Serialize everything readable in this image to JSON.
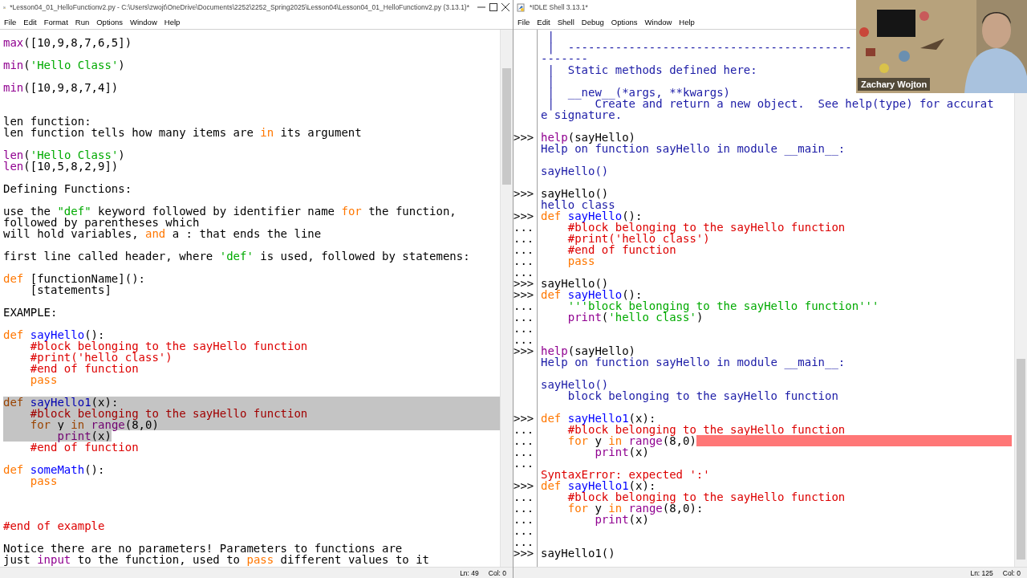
{
  "editor": {
    "title": "*Lesson04_01_HelloFunctionv2.py - C:\\Users\\zwojt\\OneDrive\\Documents\\2252\\2252_Spring2025\\Lesson04\\Lesson04_01_HelloFunctionv2.py (3.13.1)*",
    "menu": [
      "File",
      "Edit",
      "Format",
      "Run",
      "Options",
      "Window",
      "Help"
    ],
    "lines": [
      {
        "kind": "line",
        "selected": false,
        "segments": [
          {
            "kind": "builtin",
            "text": "max"
          },
          {
            "kind": "plain",
            "text": "([10,9,8,7,6,5])"
          }
        ]
      },
      {
        "kind": "blank"
      },
      {
        "kind": "line",
        "selected": false,
        "segments": [
          {
            "kind": "builtin",
            "text": "min"
          },
          {
            "kind": "plain",
            "text": "("
          },
          {
            "kind": "string",
            "text": "'Hello Class'"
          },
          {
            "kind": "plain",
            "text": ")"
          }
        ]
      },
      {
        "kind": "blank"
      },
      {
        "kind": "line",
        "selected": false,
        "segments": [
          {
            "kind": "builtin",
            "text": "min"
          },
          {
            "kind": "plain",
            "text": "([10,9,8,7,4])"
          }
        ]
      },
      {
        "kind": "blank"
      },
      {
        "kind": "blank"
      },
      {
        "kind": "line",
        "selected": false,
        "segments": [
          {
            "kind": "plain",
            "text": "len function:"
          }
        ]
      },
      {
        "kind": "line",
        "selected": false,
        "segments": [
          {
            "kind": "plain",
            "text": "len function tells how many items are "
          },
          {
            "kind": "keyword",
            "text": "in"
          },
          {
            "kind": "plain",
            "text": " its argument"
          }
        ]
      },
      {
        "kind": "blank"
      },
      {
        "kind": "line",
        "selected": false,
        "segments": [
          {
            "kind": "builtin",
            "text": "len"
          },
          {
            "kind": "plain",
            "text": "("
          },
          {
            "kind": "string",
            "text": "'Hello Class'"
          },
          {
            "kind": "plain",
            "text": ")"
          }
        ]
      },
      {
        "kind": "line",
        "selected": false,
        "segments": [
          {
            "kind": "builtin",
            "text": "len"
          },
          {
            "kind": "plain",
            "text": "([10,5,8,2,9])"
          }
        ]
      },
      {
        "kind": "blank"
      },
      {
        "kind": "line",
        "selected": false,
        "segments": [
          {
            "kind": "plain",
            "text": "Defining Functions:"
          }
        ]
      },
      {
        "kind": "blank"
      },
      {
        "kind": "line",
        "selected": false,
        "segments": [
          {
            "kind": "plain",
            "text": "use the "
          },
          {
            "kind": "string",
            "text": "\"def\""
          },
          {
            "kind": "plain",
            "text": " keyword followed by identifier name "
          },
          {
            "kind": "keyword",
            "text": "for"
          },
          {
            "kind": "plain",
            "text": " the function,"
          }
        ]
      },
      {
        "kind": "line",
        "selected": false,
        "segments": [
          {
            "kind": "plain",
            "text": "followed by parentheses which"
          }
        ]
      },
      {
        "kind": "line",
        "selected": false,
        "segments": [
          {
            "kind": "plain",
            "text": "will hold variables, "
          },
          {
            "kind": "keyword",
            "text": "and"
          },
          {
            "kind": "plain",
            "text": " a : that ends the line"
          }
        ]
      },
      {
        "kind": "blank"
      },
      {
        "kind": "line",
        "selected": false,
        "segments": [
          {
            "kind": "plain",
            "text": "first line called header, where "
          },
          {
            "kind": "string",
            "text": "'def'"
          },
          {
            "kind": "plain",
            "text": " is used, followed by statemens:"
          }
        ]
      },
      {
        "kind": "blank"
      },
      {
        "kind": "line",
        "selected": false,
        "segments": [
          {
            "kind": "keyword",
            "text": "def"
          },
          {
            "kind": "plain",
            "text": " [functionName]():"
          }
        ]
      },
      {
        "kind": "line",
        "selected": false,
        "segments": [
          {
            "kind": "plain",
            "text": "    [statements]"
          }
        ]
      },
      {
        "kind": "blank"
      },
      {
        "kind": "line",
        "selected": false,
        "segments": [
          {
            "kind": "plain",
            "text": "EXAMPLE:"
          }
        ]
      },
      {
        "kind": "blank"
      },
      {
        "kind": "line",
        "selected": false,
        "segments": [
          {
            "kind": "keyword",
            "text": "def"
          },
          {
            "kind": "definition",
            "text": " sayHello"
          },
          {
            "kind": "plain",
            "text": "():"
          }
        ]
      },
      {
        "kind": "line",
        "selected": false,
        "segments": [
          {
            "kind": "comment",
            "text": "    #block belonging to the sayHello function"
          }
        ]
      },
      {
        "kind": "line",
        "selected": false,
        "segments": [
          {
            "kind": "comment",
            "text": "    #print('hello class')"
          }
        ]
      },
      {
        "kind": "line",
        "selected": false,
        "segments": [
          {
            "kind": "comment",
            "text": "    #end of function"
          }
        ]
      },
      {
        "kind": "line",
        "selected": false,
        "segments": [
          {
            "kind": "keyword",
            "text": "    pass"
          }
        ]
      },
      {
        "kind": "blank"
      },
      {
        "kind": "line",
        "selected": true,
        "segments": [
          {
            "kind": "keyword",
            "text": "def"
          },
          {
            "kind": "definition",
            "text": " sayHello1"
          },
          {
            "kind": "plain",
            "text": "(x):"
          }
        ]
      },
      {
        "kind": "line",
        "selected": true,
        "segments": [
          {
            "kind": "comment",
            "text": "    #block belonging to the sayHello function"
          }
        ]
      },
      {
        "kind": "line",
        "selected": true,
        "segments": [
          {
            "kind": "keyword",
            "text": "    for"
          },
          {
            "kind": "plain",
            "text": " y "
          },
          {
            "kind": "keyword",
            "text": "in"
          },
          {
            "kind": "builtin",
            "text": " range"
          },
          {
            "kind": "plain",
            "text": "(8,0)"
          }
        ]
      },
      {
        "kind": "line",
        "selected": true,
        "segments": [
          {
            "kind": "builtin",
            "text": "        print"
          },
          {
            "kind": "plain",
            "text": "(x)"
          }
        ]
      },
      {
        "kind": "line",
        "selected": false,
        "segments": [
          {
            "kind": "comment",
            "text": "    #end of function"
          }
        ]
      },
      {
        "kind": "blank"
      },
      {
        "kind": "line",
        "selected": false,
        "segments": [
          {
            "kind": "keyword",
            "text": "def"
          },
          {
            "kind": "definition",
            "text": " someMath"
          },
          {
            "kind": "plain",
            "text": "():"
          }
        ]
      },
      {
        "kind": "line",
        "selected": false,
        "segments": [
          {
            "kind": "keyword",
            "text": "    pass"
          }
        ]
      },
      {
        "kind": "blank"
      },
      {
        "kind": "blank"
      },
      {
        "kind": "blank"
      },
      {
        "kind": "line",
        "selected": false,
        "segments": [
          {
            "kind": "comment",
            "text": "#end of example"
          }
        ]
      },
      {
        "kind": "blank"
      },
      {
        "kind": "line",
        "selected": false,
        "segments": [
          {
            "kind": "plain",
            "text": "Notice there are no parameters! Parameters to functions are"
          }
        ]
      },
      {
        "kind": "line",
        "selected": false,
        "segments": [
          {
            "kind": "plain",
            "text": "just "
          },
          {
            "kind": "builtin",
            "text": "input"
          },
          {
            "kind": "plain",
            "text": " to the function, used to "
          },
          {
            "kind": "keyword",
            "text": "pass"
          },
          {
            "kind": "plain",
            "text": " different values to it"
          }
        ]
      }
    ],
    "status": {
      "line": "Ln: 49",
      "column": "Col: 0"
    }
  },
  "shell": {
    "title": "*IDLE Shell 3.13.1*",
    "menu": [
      "File",
      "Edit",
      "Shell",
      "Debug",
      "Options",
      "Window",
      "Help"
    ],
    "lines": [
      {
        "kind": "line",
        "error_highlight": false,
        "segments": [
          {
            "kind": "output",
            "text": " |"
          }
        ]
      },
      {
        "kind": "line",
        "error_highlight": false,
        "segments": [
          {
            "kind": "output",
            "text": " |  ------------------------------------------"
          }
        ]
      },
      {
        "kind": "line",
        "error_highlight": false,
        "segments": [
          {
            "kind": "output",
            "text": "-------"
          }
        ]
      },
      {
        "kind": "line",
        "error_highlight": false,
        "segments": [
          {
            "kind": "output",
            "text": " |  Static methods defined here:"
          }
        ]
      },
      {
        "kind": "line",
        "error_highlight": false,
        "segments": [
          {
            "kind": "output",
            "text": " |"
          }
        ]
      },
      {
        "kind": "line",
        "error_highlight": false,
        "segments": [
          {
            "kind": "output",
            "text": " |  __new__(*args, **kwargs)"
          }
        ]
      },
      {
        "kind": "line",
        "error_highlight": false,
        "segments": [
          {
            "kind": "output",
            "text": " |      Create and return a new object.  See help(type) for accurat"
          }
        ]
      },
      {
        "kind": "line",
        "error_highlight": false,
        "segments": [
          {
            "kind": "output",
            "text": "e signature."
          }
        ]
      },
      {
        "kind": "blank"
      },
      {
        "kind": "line",
        "prompt": ">>>",
        "error_highlight": false,
        "segments": [
          {
            "kind": "builtin",
            "text": "help"
          },
          {
            "kind": "plain",
            "text": "(sayHello)"
          }
        ]
      },
      {
        "kind": "line",
        "error_highlight": false,
        "segments": [
          {
            "kind": "output",
            "text": "Help on function sayHello in module __main__:"
          }
        ]
      },
      {
        "kind": "blank"
      },
      {
        "kind": "line",
        "error_highlight": false,
        "segments": [
          {
            "kind": "output",
            "text": "sayHello()"
          }
        ]
      },
      {
        "kind": "blank"
      },
      {
        "kind": "line",
        "prompt": ">>>",
        "error_highlight": false,
        "segments": [
          {
            "kind": "plain",
            "text": "sayHello()"
          }
        ]
      },
      {
        "kind": "line",
        "error_highlight": false,
        "segments": [
          {
            "kind": "output",
            "text": "hello class"
          }
        ]
      },
      {
        "kind": "line",
        "prompt": ">>>",
        "error_highlight": false,
        "segments": [
          {
            "kind": "keyword",
            "text": "def"
          },
          {
            "kind": "definition",
            "text": " sayHello"
          },
          {
            "kind": "plain",
            "text": "():"
          }
        ]
      },
      {
        "kind": "line",
        "prompt": "...",
        "error_highlight": false,
        "segments": [
          {
            "kind": "comment",
            "text": "    #block belonging to the sayHello function"
          }
        ]
      },
      {
        "kind": "line",
        "prompt": "...",
        "error_highlight": false,
        "segments": [
          {
            "kind": "comment",
            "text": "    #print('hello class')"
          }
        ]
      },
      {
        "kind": "line",
        "prompt": "...",
        "error_highlight": false,
        "segments": [
          {
            "kind": "comment",
            "text": "    #end of function"
          }
        ]
      },
      {
        "kind": "line",
        "prompt": "...",
        "error_highlight": false,
        "segments": [
          {
            "kind": "keyword",
            "text": "    pass"
          }
        ]
      },
      {
        "kind": "line",
        "prompt": "...",
        "error_highlight": false
      },
      {
        "kind": "line",
        "prompt": ">>>",
        "error_highlight": false,
        "segments": [
          {
            "kind": "plain",
            "text": "sayHello()"
          }
        ]
      },
      {
        "kind": "line",
        "prompt": ">>>",
        "error_highlight": false,
        "segments": [
          {
            "kind": "keyword",
            "text": "def"
          },
          {
            "kind": "definition",
            "text": " sayHello"
          },
          {
            "kind": "plain",
            "text": "():"
          }
        ]
      },
      {
        "kind": "line",
        "prompt": "...",
        "error_highlight": false,
        "segments": [
          {
            "kind": "string",
            "text": "    '''block belonging to the sayHello function'''"
          }
        ]
      },
      {
        "kind": "line",
        "prompt": "...",
        "error_highlight": false,
        "segments": [
          {
            "kind": "builtin",
            "text": "    print"
          },
          {
            "kind": "plain",
            "text": "("
          },
          {
            "kind": "string",
            "text": "'hello class'"
          },
          {
            "kind": "plain",
            "text": ")"
          }
        ]
      },
      {
        "kind": "line",
        "prompt": "...",
        "error_highlight": false
      },
      {
        "kind": "line",
        "prompt": "...",
        "error_highlight": false
      },
      {
        "kind": "line",
        "prompt": ">>>",
        "error_highlight": false,
        "segments": [
          {
            "kind": "builtin",
            "text": "help"
          },
          {
            "kind": "plain",
            "text": "(sayHello)"
          }
        ]
      },
      {
        "kind": "line",
        "error_highlight": false,
        "segments": [
          {
            "kind": "output",
            "text": "Help on function sayHello in module __main__:"
          }
        ]
      },
      {
        "kind": "blank"
      },
      {
        "kind": "line",
        "error_highlight": false,
        "segments": [
          {
            "kind": "output",
            "text": "sayHello()"
          }
        ]
      },
      {
        "kind": "line",
        "error_highlight": false,
        "segments": [
          {
            "kind": "output",
            "text": "    block belonging to the sayHello function"
          }
        ]
      },
      {
        "kind": "blank"
      },
      {
        "kind": "line",
        "prompt": ">>>",
        "error_highlight": false,
        "segments": [
          {
            "kind": "keyword",
            "text": "def"
          },
          {
            "kind": "definition",
            "text": " sayHello1"
          },
          {
            "kind": "plain",
            "text": "(x):"
          }
        ]
      },
      {
        "kind": "line",
        "prompt": "...",
        "error_highlight": false,
        "segments": [
          {
            "kind": "comment",
            "text": "    #block belonging to the sayHello function"
          }
        ]
      },
      {
        "kind": "line",
        "prompt": "...",
        "error_highlight": true,
        "segments": [
          {
            "kind": "keyword",
            "text": "    for"
          },
          {
            "kind": "plain",
            "text": " y "
          },
          {
            "kind": "keyword",
            "text": "in"
          },
          {
            "kind": "builtin",
            "text": " range"
          },
          {
            "kind": "plain",
            "text": "(8,0)"
          }
        ]
      },
      {
        "kind": "line",
        "prompt": "...",
        "error_highlight": false,
        "segments": [
          {
            "kind": "builtin",
            "text": "        print"
          },
          {
            "kind": "plain",
            "text": "(x)"
          }
        ]
      },
      {
        "kind": "line",
        "prompt": "...",
        "error_highlight": false
      },
      {
        "kind": "line",
        "error_highlight": false,
        "segments": [
          {
            "kind": "error",
            "text": "SyntaxError: expected ':'"
          }
        ]
      },
      {
        "kind": "line",
        "prompt": ">>>",
        "error_highlight": false,
        "segments": [
          {
            "kind": "keyword",
            "text": "def"
          },
          {
            "kind": "definition",
            "text": " sayHello1"
          },
          {
            "kind": "plain",
            "text": "(x):"
          }
        ]
      },
      {
        "kind": "line",
        "prompt": "...",
        "error_highlight": false,
        "segments": [
          {
            "kind": "comment",
            "text": "    #block belonging to the sayHello function"
          }
        ]
      },
      {
        "kind": "line",
        "prompt": "...",
        "error_highlight": false,
        "segments": [
          {
            "kind": "keyword",
            "text": "    for"
          },
          {
            "kind": "plain",
            "text": " y "
          },
          {
            "kind": "keyword",
            "text": "in"
          },
          {
            "kind": "builtin",
            "text": " range"
          },
          {
            "kind": "plain",
            "text": "(8,0):"
          }
        ]
      },
      {
        "kind": "line",
        "prompt": "...",
        "error_highlight": false,
        "segments": [
          {
            "kind": "builtin",
            "text": "        print"
          },
          {
            "kind": "plain",
            "text": "(x)"
          }
        ]
      },
      {
        "kind": "line",
        "prompt": "...",
        "error_highlight": false
      },
      {
        "kind": "line",
        "prompt": "...",
        "error_highlight": false
      },
      {
        "kind": "line",
        "prompt": ">>>",
        "error_highlight": false,
        "segments": [
          {
            "kind": "plain",
            "text": "sayHello1()"
          }
        ]
      }
    ],
    "status": {
      "line": "Ln: 125",
      "column": "Col: 0"
    }
  },
  "webcam": {
    "kind": "picture",
    "name": "Zachary Wojton"
  }
}
